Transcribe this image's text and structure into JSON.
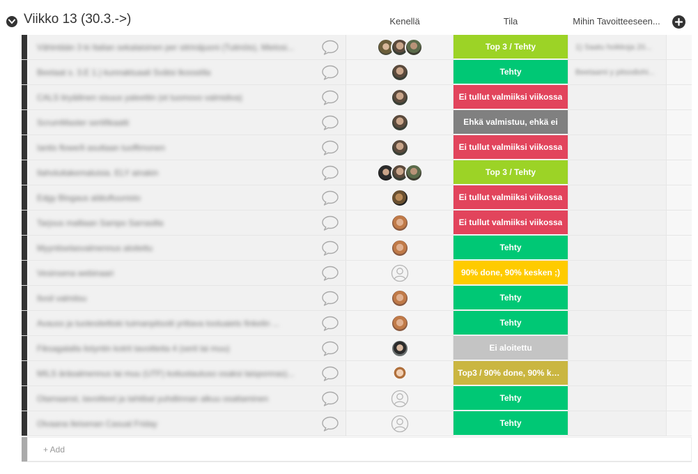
{
  "group": {
    "title": "Viikko 13 (30.3.->)"
  },
  "columns": {
    "people": "Kenellä",
    "status": "Tila",
    "goal": "Mihin Tavoitteeseen..."
  },
  "colors": {
    "top3_tehty": "#9cd326",
    "tehty": "#00c875",
    "ei_tullut": "#e2445c",
    "ehka": "#808080",
    "done90": "#ffcb00",
    "ei_aloitettu": "#c4c4c4",
    "top3_done90": "#cab641"
  },
  "rows": [
    {
      "name": "Vähintään 3 ki Italian sekalaisinen per sitrinäjuoni (Tutinöis), Mielosi...",
      "people": [
        "p2",
        "p1",
        "p3"
      ],
      "status": "Top 3 / Tehty",
      "status_color": "#9cd326",
      "goal": "1) Saatu hoikkoja 20..."
    },
    {
      "name": "Beetaat s. 3.E 1.) kunnaktuaali Svätsi lkoosélla",
      "people": [
        "p1"
      ],
      "status": "Tehty",
      "status_color": "#00c875",
      "goal": "Beetaami y pitsodiohi..."
    },
    {
      "name": "CALS tiryäilinen sisuus yaleettin (et tuomovo valmidiva)",
      "people": [
        "p1"
      ],
      "status": "Ei tullut valmiiksi viikossa",
      "status_color": "#e2445c",
      "goal": ""
    },
    {
      "name": "ScrumMaster sertifikaatti",
      "people": [
        "p1"
      ],
      "status": "Ehkä valmistuu, ehkä ei",
      "status_color": "#808080",
      "goal": ""
    },
    {
      "name": "Iantis flowe/li asuttaan tuoffimonen",
      "people": [
        "p1"
      ],
      "status": "Ei tullut valmiiksi viikossa",
      "status_color": "#e2445c",
      "goal": ""
    },
    {
      "name": "Ilaholuitakemaluisia. ELY ainakin",
      "people": [
        "p4",
        "p1",
        "p3"
      ],
      "status": "Top 3 / Tehty",
      "status_color": "#9cd326",
      "goal": ""
    },
    {
      "name": "Edgy Blogaus alätuftuunisto",
      "people": [
        "p5"
      ],
      "status": "Ei tullut valmiiksi viikossa",
      "status_color": "#e2445c",
      "goal": ""
    },
    {
      "name": "Tarjous malliaan Sampo Sarrasilla",
      "people": [
        "p6"
      ],
      "status": "Ei tullut valmiiksi viikossa",
      "status_color": "#e2445c",
      "goal": ""
    },
    {
      "name": "Myyntiselasvalmennus aloitettu",
      "people": [
        "p6"
      ],
      "status": "Tehty",
      "status_color": "#00c875",
      "goal": ""
    },
    {
      "name": "Vesinsena webinaari",
      "people": [
        "empty"
      ],
      "status": "90% done, 90% kesken ;)",
      "status_color": "#ffcb00",
      "goal": ""
    },
    {
      "name": "Ilvoil valmitsu",
      "people": [
        "p6"
      ],
      "status": "Tehty",
      "status_color": "#00c875",
      "goal": ""
    },
    {
      "name": "Avauss ja tuotesiteltiski tuimanpitsoiti yrittava tooluaiets finkelin ...",
      "people": [
        "p6"
      ],
      "status": "Tehty",
      "status_color": "#00c875",
      "goal": ""
    },
    {
      "name": "Fiksagalalla listyntin kotrit tavoitteita 4 (serit lai muu)",
      "people": [
        "p7"
      ],
      "status": "Ei aloitettu",
      "status_color": "#c4c4c4",
      "goal": ""
    },
    {
      "name": "MILS äräsalmennus lai muu (UTF) kotiustautuso osaksi laisponnas)...",
      "people": [
        "p8"
      ],
      "status": "Top3 / 90% done, 90% kes...",
      "status_color": "#cab641",
      "goal": ""
    },
    {
      "name": "Otamaanst, tavoitteet ja tahtibat yuhdtinnan alkuu osattaminen",
      "people": [
        "empty"
      ],
      "status": "Tehty",
      "status_color": "#00c875",
      "goal": ""
    },
    {
      "name": "Olvaana lleisenan Casual Friday",
      "people": [
        "empty"
      ],
      "status": "Tehty",
      "status_color": "#00c875",
      "goal": ""
    }
  ],
  "add_row": {
    "label": "+ Add"
  }
}
